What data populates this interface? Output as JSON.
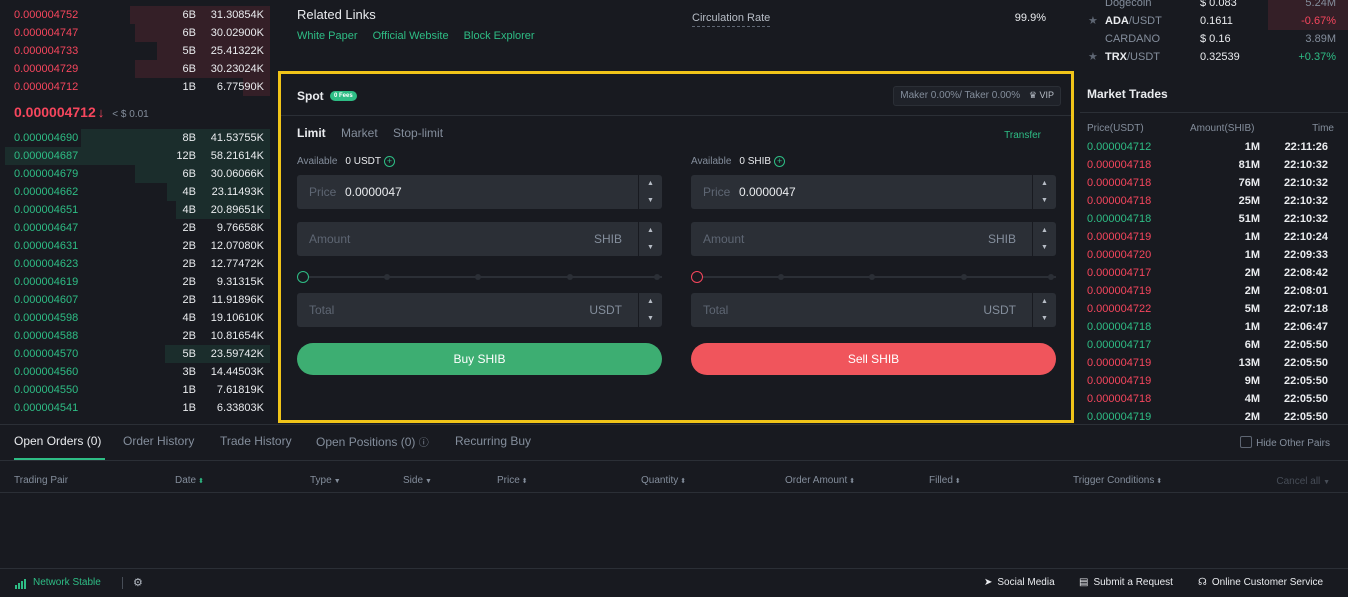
{
  "orderbook": {
    "asks": [
      {
        "price": "0.000004752",
        "count": "6B",
        "total": "31.30854K",
        "depth": 0.52
      },
      {
        "price": "0.000004747",
        "count": "6B",
        "total": "30.02900K",
        "depth": 0.5
      },
      {
        "price": "0.000004733",
        "count": "5B",
        "total": "25.41322K",
        "depth": 0.42
      },
      {
        "price": "0.000004729",
        "count": "6B",
        "total": "30.23024K",
        "depth": 0.5
      },
      {
        "price": "0.000004712",
        "count": "1B",
        "total": "6.77590K",
        "depth": 0.1
      }
    ],
    "last_price": "0.000004712",
    "last_arrow": "↓",
    "last_usd": "< $ 0.01",
    "bids": [
      {
        "price": "0.000004690",
        "count": "8B",
        "total": "41.53755K",
        "depth": 0.7
      },
      {
        "price": "0.000004687",
        "count": "12B",
        "total": "58.21614K",
        "depth": 0.98
      },
      {
        "price": "0.000004679",
        "count": "6B",
        "total": "30.06066K",
        "depth": 0.5
      },
      {
        "price": "0.000004662",
        "count": "4B",
        "total": "23.11493K",
        "depth": 0.38
      },
      {
        "price": "0.000004651",
        "count": "4B",
        "total": "20.89651K",
        "depth": 0.35
      },
      {
        "price": "0.000004647",
        "count": "2B",
        "total": "9.76658K",
        "depth": 0.0
      },
      {
        "price": "0.000004631",
        "count": "2B",
        "total": "12.07080K",
        "depth": 0.0
      },
      {
        "price": "0.000004623",
        "count": "2B",
        "total": "12.77472K",
        "depth": 0.0
      },
      {
        "price": "0.000004619",
        "count": "2B",
        "total": "9.31315K",
        "depth": 0.0
      },
      {
        "price": "0.000004607",
        "count": "2B",
        "total": "11.91896K",
        "depth": 0.0
      },
      {
        "price": "0.000004598",
        "count": "4B",
        "total": "19.10610K",
        "depth": 0.0
      },
      {
        "price": "0.000004588",
        "count": "2B",
        "total": "10.81654K",
        "depth": 0.0
      },
      {
        "price": "0.000004570",
        "count": "5B",
        "total": "23.59742K",
        "depth": 0.39
      },
      {
        "price": "0.000004560",
        "count": "3B",
        "total": "14.44503K",
        "depth": 0.0
      },
      {
        "price": "0.000004550",
        "count": "1B",
        "total": "7.61819K",
        "depth": 0.0
      },
      {
        "price": "0.000004541",
        "count": "1B",
        "total": "6.33803K",
        "depth": 0.0
      }
    ]
  },
  "info": {
    "title": "Related Links",
    "links": [
      "White Paper",
      "Official Website",
      "Block Explorer"
    ],
    "circulation_label": "Circulation Rate",
    "circulation_value": "99.9%"
  },
  "spot": {
    "title": "Spot",
    "fees_badge": "0 Fees",
    "fee_rate": "Maker 0.00%/ Taker 0.00%",
    "vip_label": "VIP",
    "tabs": [
      "Limit",
      "Market",
      "Stop-limit"
    ],
    "transfer": "Transfer",
    "buy": {
      "available_label": "Available",
      "available_value": "0 USDT",
      "price_label": "Price",
      "price_value": "0.0000047",
      "amount_placeholder": "Amount",
      "amount_unit": "SHIB",
      "total_placeholder": "Total",
      "total_unit": "USDT",
      "button": "Buy SHIB"
    },
    "sell": {
      "available_label": "Available",
      "available_value": "0 SHIB",
      "price_label": "Price",
      "price_value": "0.0000047",
      "amount_placeholder": "Amount",
      "amount_unit": "SHIB",
      "total_placeholder": "Total",
      "total_unit": "USDT",
      "button": "Sell SHIB"
    }
  },
  "market_list": [
    {
      "pair": "",
      "quote": "Dogecoin",
      "price": "$ 0.083",
      "change": "5.24M",
      "change_color": "muted"
    },
    {
      "pair": "ADA",
      "quote": "/USDT",
      "price": "0.1611",
      "change": "-0.67%",
      "change_color": "red"
    },
    {
      "pair": "",
      "quote": "CARDANO",
      "price": "$ 0.16",
      "change": "3.89M",
      "change_color": "muted"
    },
    {
      "pair": "TRX",
      "quote": "/USDT",
      "price": "0.32539",
      "change": "+0.37%",
      "change_color": "green"
    }
  ],
  "market_trades": {
    "title": "Market Trades",
    "headers": {
      "price": "Price(USDT)",
      "amount": "Amount(SHIB)",
      "time": "Time"
    },
    "rows": [
      {
        "price": "0.000004712",
        "amount": "1M",
        "time": "22:11:26",
        "side": "green"
      },
      {
        "price": "0.000004718",
        "amount": "81M",
        "time": "22:10:32",
        "side": "red"
      },
      {
        "price": "0.000004718",
        "amount": "76M",
        "time": "22:10:32",
        "side": "red"
      },
      {
        "price": "0.000004718",
        "amount": "25M",
        "time": "22:10:32",
        "side": "red"
      },
      {
        "price": "0.000004718",
        "amount": "51M",
        "time": "22:10:32",
        "side": "green"
      },
      {
        "price": "0.000004719",
        "amount": "1M",
        "time": "22:10:24",
        "side": "red"
      },
      {
        "price": "0.000004720",
        "amount": "1M",
        "time": "22:09:33",
        "side": "red"
      },
      {
        "price": "0.000004717",
        "amount": "2M",
        "time": "22:08:42",
        "side": "red"
      },
      {
        "price": "0.000004719",
        "amount": "2M",
        "time": "22:08:01",
        "side": "red"
      },
      {
        "price": "0.000004722",
        "amount": "5M",
        "time": "22:07:18",
        "side": "red"
      },
      {
        "price": "0.000004718",
        "amount": "1M",
        "time": "22:06:47",
        "side": "green"
      },
      {
        "price": "0.000004717",
        "amount": "6M",
        "time": "22:05:50",
        "side": "green"
      },
      {
        "price": "0.000004719",
        "amount": "13M",
        "time": "22:05:50",
        "side": "red"
      },
      {
        "price": "0.000004719",
        "amount": "9M",
        "time": "22:05:50",
        "side": "red"
      },
      {
        "price": "0.000004718",
        "amount": "4M",
        "time": "22:05:50",
        "side": "red"
      },
      {
        "price": "0.000004719",
        "amount": "2M",
        "time": "22:05:50",
        "side": "green"
      }
    ]
  },
  "orders": {
    "tabs": [
      "Open Orders (0)",
      "Order History",
      "Trade History",
      "Open Positions (0)",
      "Recurring Buy"
    ],
    "hide_other": "Hide Other Pairs",
    "columns": [
      "Trading Pair",
      "Date",
      "Type",
      "Side",
      "Price",
      "Quantity",
      "Order Amount",
      "Filled",
      "Trigger Conditions"
    ],
    "cancel_all": "Cancel all"
  },
  "footer": {
    "network": "Network Stable",
    "social": "Social Media",
    "request": "Submit a Request",
    "support": "Online Customer Service"
  }
}
